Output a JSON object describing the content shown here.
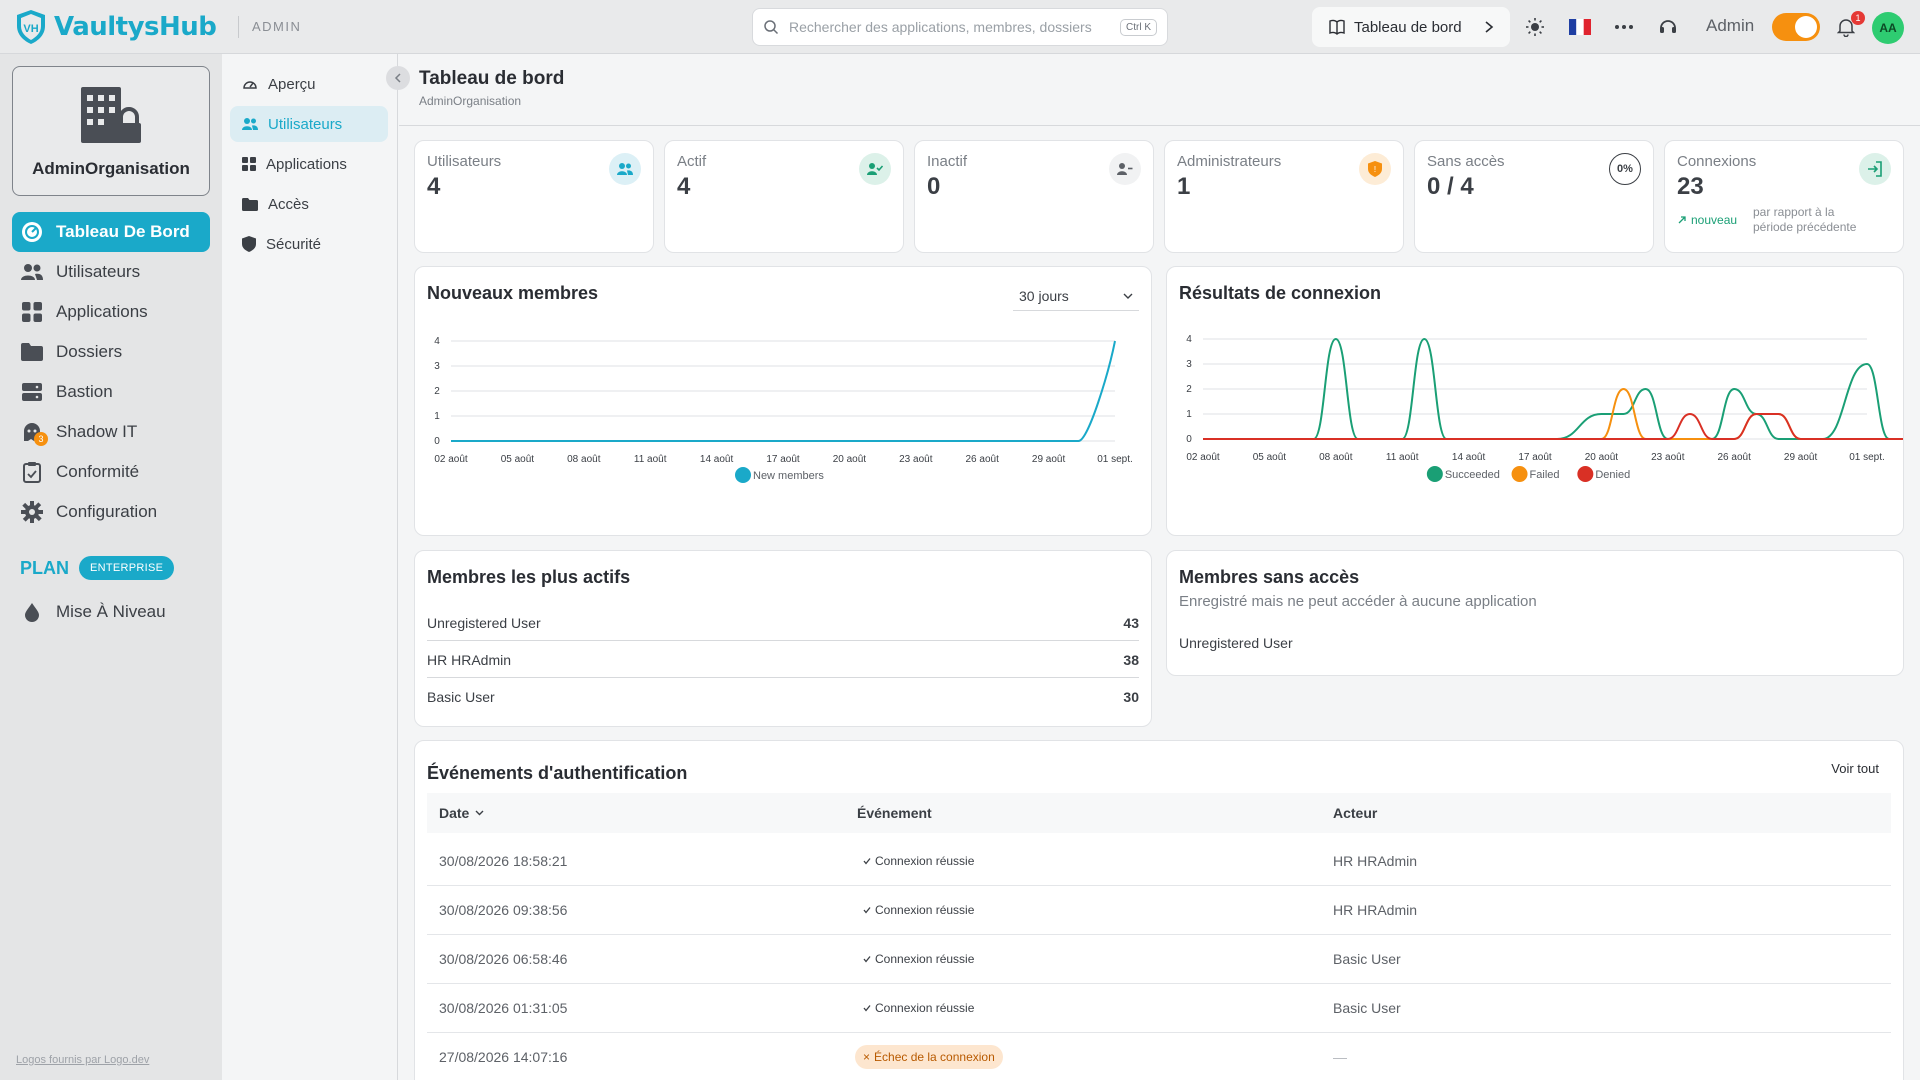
{
  "app": {
    "name": "VaultysHub",
    "section": "ADMIN"
  },
  "search": {
    "placeholder": "Rechercher des applications, membres, dossiers",
    "shortcut": "Ctrl K"
  },
  "topbar": {
    "breadcrumb_button": "Tableau de bord",
    "admin_label": "Admin",
    "notification_count": "1",
    "avatar_initials": "AA",
    "icons": [
      "sun-icon",
      "french-flag-icon",
      "more-icon",
      "support-icon",
      "bell-icon"
    ]
  },
  "sidebar": {
    "org_name": "AdminOrganisation",
    "items": [
      {
        "label": "Tableau De Bord",
        "icon": "dashboard-icon",
        "active": true
      },
      {
        "label": "Utilisateurs",
        "icon": "users-icon"
      },
      {
        "label": "Applications",
        "icon": "apps-icon"
      },
      {
        "label": "Dossiers",
        "icon": "folder-icon"
      },
      {
        "label": "Bastion",
        "icon": "server-icon"
      },
      {
        "label": "Shadow IT",
        "icon": "ghost-icon",
        "badge": "3"
      },
      {
        "label": "Conformité",
        "icon": "clipboard-icon"
      },
      {
        "label": "Configuration",
        "icon": "gear-icon"
      }
    ],
    "plan_label": "PLAN",
    "plan_badge": "ENTERPRISE",
    "upgrade_label": "Mise À Niveau",
    "footer": "Logos fournis par Logo.dev"
  },
  "subnav": {
    "items": [
      {
        "label": "Aperçu",
        "icon": "gauge-icon"
      },
      {
        "label": "Utilisateurs",
        "icon": "users-icon",
        "active": true
      },
      {
        "label": "Applications",
        "icon": "apps-icon"
      },
      {
        "label": "Accès",
        "icon": "folder-icon"
      },
      {
        "label": "Sécurité",
        "icon": "shield-icon"
      }
    ]
  },
  "page": {
    "title": "Tableau de bord",
    "subtitle": "AdminOrganisation"
  },
  "stats": [
    {
      "label": "Utilisateurs",
      "value": "4",
      "icon": "users-icon",
      "color": "#1aa9c9"
    },
    {
      "label": "Actif",
      "value": "4",
      "icon": "user-check-icon",
      "color": "#1a9f75"
    },
    {
      "label": "Inactif",
      "value": "0",
      "icon": "user-minus-icon",
      "color": "#5d6167"
    },
    {
      "label": "Administrateurs",
      "value": "1",
      "icon": "shield-icon",
      "color": "#f6900f"
    },
    {
      "label": "Sans accès",
      "value": "0 / 4",
      "icon": "percent-icon",
      "icon_text": "0%",
      "color": "#3b3f45"
    },
    {
      "label": "Connexions",
      "value": "23",
      "icon": "login-icon",
      "color": "#1a9f75",
      "trend": "nouveau",
      "trend_note": "par rapport à la période précédente"
    }
  ],
  "new_members": {
    "title": "Nouveaux membres",
    "range": "30 jours"
  },
  "login_results": {
    "title": "Résultats de connexion"
  },
  "chart_data": [
    {
      "type": "line",
      "title": "Nouveaux membres",
      "categories": [
        "02 août",
        "05 août",
        "08 août",
        "11 août",
        "14 août",
        "17 août",
        "20 août",
        "23 août",
        "26 août",
        "29 août",
        "01 sept."
      ],
      "series": [
        {
          "name": "New members",
          "color": "#1aa9c9",
          "values": [
            0,
            0,
            0,
            0,
            0,
            0,
            0,
            0,
            0,
            0,
            4
          ]
        }
      ],
      "ylim": [
        0,
        4
      ],
      "yticks": [
        0,
        1,
        2,
        3,
        4
      ],
      "legend": "bottom"
    },
    {
      "type": "line",
      "title": "Résultats de connexion",
      "x": [
        0,
        3,
        5,
        6,
        7,
        9,
        10,
        11,
        12,
        14,
        16,
        18,
        19,
        20,
        21,
        22,
        23,
        24,
        25,
        26,
        27,
        28,
        30,
        31,
        33
      ],
      "categories": [
        "02 août",
        "05 août",
        "08 août",
        "11 août",
        "14 août",
        "17 août",
        "20 août",
        "23 août",
        "26 août",
        "29 août",
        "01 sept."
      ],
      "series": [
        {
          "name": "Succeeded",
          "color": "#1a9f75",
          "values": [
            0,
            0,
            0,
            4,
            0,
            0,
            4,
            0,
            0,
            0,
            0,
            1,
            1,
            2,
            0,
            0,
            0,
            2,
            1,
            0,
            0,
            0,
            3,
            0,
            0
          ]
        },
        {
          "name": "Failed",
          "color": "#f6900f",
          "values": [
            0,
            0,
            0,
            0,
            0,
            0,
            0,
            0,
            0,
            0,
            0,
            0,
            2,
            0,
            0,
            0,
            0,
            0,
            1,
            1,
            0,
            0,
            0,
            0,
            0
          ]
        },
        {
          "name": "Denied",
          "color": "#d93025",
          "values": [
            0,
            0,
            0,
            0,
            0,
            0,
            0,
            0,
            0,
            0,
            0,
            0,
            0,
            0,
            0,
            1,
            0,
            0,
            1,
            1,
            0,
            0,
            0,
            0,
            0
          ]
        }
      ],
      "ylim": [
        0,
        4
      ],
      "yticks": [
        0,
        1,
        2,
        3,
        4
      ],
      "legend": "bottom"
    }
  ],
  "active_members": {
    "title": "Membres les plus actifs",
    "rows": [
      {
        "name": "Unregistered User",
        "value": "43"
      },
      {
        "name": "HR HRAdmin",
        "value": "38"
      },
      {
        "name": "Basic User",
        "value": "30"
      }
    ]
  },
  "no_access": {
    "title": "Membres sans accès",
    "description": "Enregistré mais ne peut accéder à aucune application",
    "rows": [
      "Unregistered User"
    ]
  },
  "auth_events": {
    "title": "Événements d'authentification",
    "view_all": "Voir tout",
    "columns": {
      "date": "Date",
      "event": "Événement",
      "actor": "Acteur"
    },
    "rows": [
      {
        "date": "30/08/2026 18:58:21",
        "event": "Connexion réussie",
        "status": "success",
        "actor": "HR HRAdmin"
      },
      {
        "date": "30/08/2026 09:38:56",
        "event": "Connexion réussie",
        "status": "success",
        "actor": "HR HRAdmin"
      },
      {
        "date": "30/08/2026 06:58:46",
        "event": "Connexion réussie",
        "status": "success",
        "actor": "Basic User"
      },
      {
        "date": "30/08/2026 01:31:05",
        "event": "Connexion réussie",
        "status": "success",
        "actor": "Basic User"
      },
      {
        "date": "27/08/2026 14:07:16",
        "event": "Échec de la connexion",
        "status": "fail",
        "actor": "—"
      }
    ]
  },
  "colors": {
    "accent": "#1aa9c9",
    "success": "#1a9f75",
    "warning": "#f6900f",
    "danger": "#d93025"
  }
}
